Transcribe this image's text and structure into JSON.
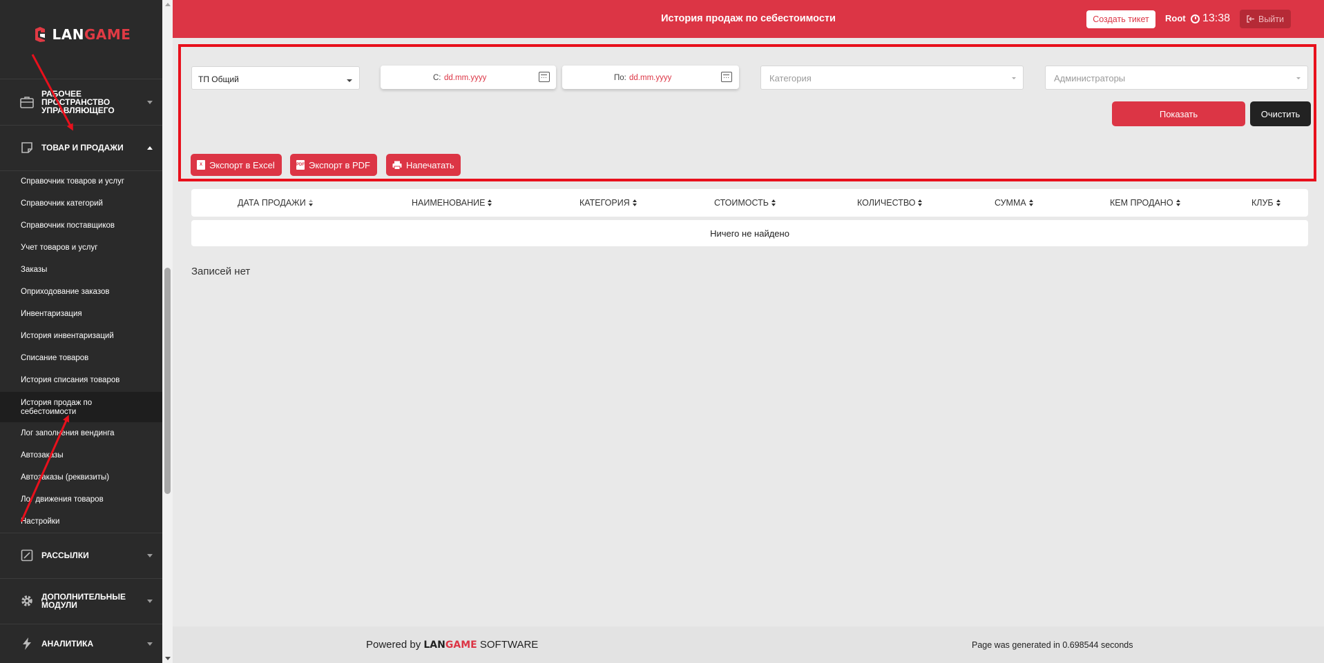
{
  "sidebar": {
    "logo": {
      "white": "LAN",
      "red": "GAME"
    },
    "sections": {
      "workspace": "Рабочее пространство управляющего",
      "products": "Товар и продажи",
      "mailings": "Рассылки",
      "modules": "Дополнительные модули",
      "analytics": "Аналитика"
    },
    "items": [
      "Справочник товаров и услуг",
      "Справочник категорий",
      "Справочник поставщиков",
      "Учет товаров и услуг",
      "Заказы",
      "Оприходование заказов",
      "Инвентаризация",
      "История инвентаризаций",
      "Списание товаров",
      "История списания товаров",
      "История продаж по себестоимости",
      "Лог заполнения вендинга",
      "Автозаказы",
      "Автозаказы (реквизиты)",
      "Лог движения товаров",
      "Настройки"
    ],
    "active_index": 10
  },
  "header": {
    "title": "История продаж по себестоимости",
    "ticket_button": "Создать тикет",
    "user": "Root",
    "time": "13:38",
    "logout": "Выйти"
  },
  "filters": {
    "club_select": "ТП Общий",
    "date_from_label": "С:",
    "date_from_value": "dd.mm.yyyy",
    "date_to_label": "По:",
    "date_to_value": "dd.mm.yyyy",
    "category_placeholder": "Категория",
    "admins_placeholder": "Администраторы",
    "show_button": "Показать",
    "clear_button": "Очистить",
    "export_excel": "Экспорт в Excel",
    "export_pdf": "Экспорт в PDF",
    "print": "Напечатать"
  },
  "table": {
    "columns": [
      "Дата продажи",
      "Наименование",
      "Категория",
      "Стоимость",
      "Количество",
      "Сумма",
      "Кем продано",
      "Клуб"
    ],
    "empty_message": "Ничего не найдено"
  },
  "no_records": "Записей нет",
  "footer": {
    "powered_prefix": "Powered by",
    "brand_white": "LAN",
    "brand_red": "GAME",
    "brand_suffix": "SOFTWARE",
    "generated": "Page was generated in 0.698544 seconds"
  },
  "colors": {
    "accent": "#dc3545",
    "sidebar_bg": "#2a2a2a",
    "annotation": "#e8101c"
  }
}
